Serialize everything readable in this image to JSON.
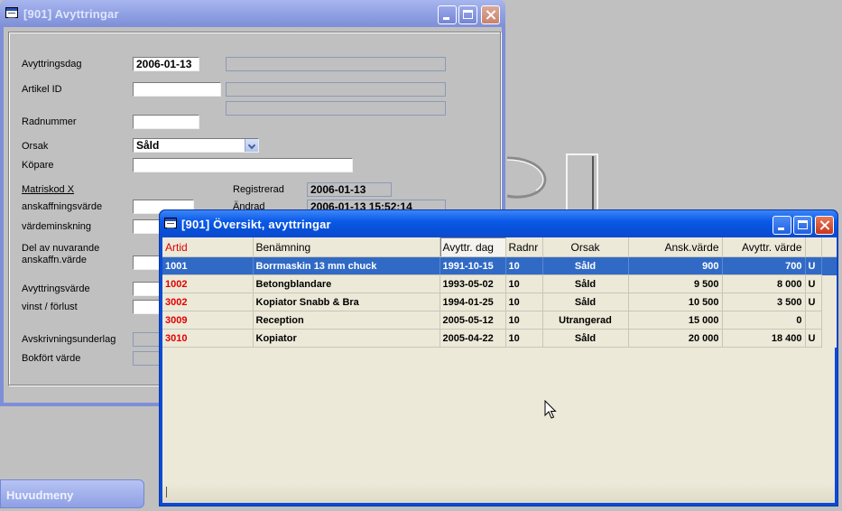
{
  "window_back": {
    "title": "[901]  Avyttringar",
    "fields": {
      "avyttringsdag_label": "Avyttringsdag",
      "avyttringsdag_value": "2006-01-13",
      "artikel_id_label": "Artikel ID",
      "artikel_id_value": "",
      "radnummer_label": "Radnummer",
      "orsak_label": "Orsak",
      "orsak_value": "Såld",
      "kopare_label": "Köpare",
      "matriskod_label": "Matriskod X",
      "anskaffningsvarde_label": "anskaffningsvärde",
      "vardeminskning_label": "värdeminskning",
      "del_av_label_1": "Del av nuvarande",
      "del_av_label_2": "anskaffn.värde",
      "avyttringsvarde_label": "Avyttringsvärde",
      "vinst_label": "vinst / förlust",
      "avskrivningsunderlag_label": "Avskrivningsunderlag",
      "bokfort_label": "Bokfört värde",
      "registrerad_label": "Registrerad",
      "registrerad_value": "2006-01-13",
      "andrad_label": "Ändrad",
      "andrad_value": "2006-01-13 15:52:14"
    }
  },
  "window_front": {
    "title": "[901]  Översikt, avyttringar",
    "columns": [
      "Artid",
      "Benämning",
      "Avyttr. dag",
      "Radnr",
      "Orsak",
      "Ansk.värde",
      "Avyttr. värde",
      ""
    ],
    "rows": [
      {
        "artid": "1001",
        "benamning": "Borrmaskin 13 mm chuck",
        "dag": "1991-10-15",
        "radnr": "10",
        "orsak": "Såld",
        "ansk": "900",
        "avyttr": "700",
        "flag": "U"
      },
      {
        "artid": "1002",
        "benamning": "Betongblandare",
        "dag": "1993-05-02",
        "radnr": "10",
        "orsak": "Såld",
        "ansk": "9 500",
        "avyttr": "8 000",
        "flag": "U"
      },
      {
        "artid": "3002",
        "benamning": "Kopiator Snabb & Bra",
        "dag": "1994-01-25",
        "radnr": "10",
        "orsak": "Såld",
        "ansk": "10 500",
        "avyttr": "3 500",
        "flag": "U"
      },
      {
        "artid": "3009",
        "benamning": "Reception",
        "dag": "2005-05-12",
        "radnr": "10",
        "orsak": "Utrangerad",
        "ansk": "15 000",
        "avyttr": "0",
        "flag": ""
      },
      {
        "artid": "3010",
        "benamning": "Kopiator",
        "dag": "2005-04-22",
        "radnr": "10",
        "orsak": "Såld",
        "ansk": "20 000",
        "avyttr": "18 400",
        "flag": "U"
      }
    ],
    "selected_row": 0
  },
  "taskbar": {
    "huvudmeny_label": "Huvudmeny"
  },
  "colors": {
    "active_title": "#0a5ae8",
    "inactive_title": "#8e9fe2",
    "selection": "#316ac5",
    "id_text_red": "#e00000",
    "form_background": "#c0c0c0",
    "grid_background": "#ece9d8"
  }
}
